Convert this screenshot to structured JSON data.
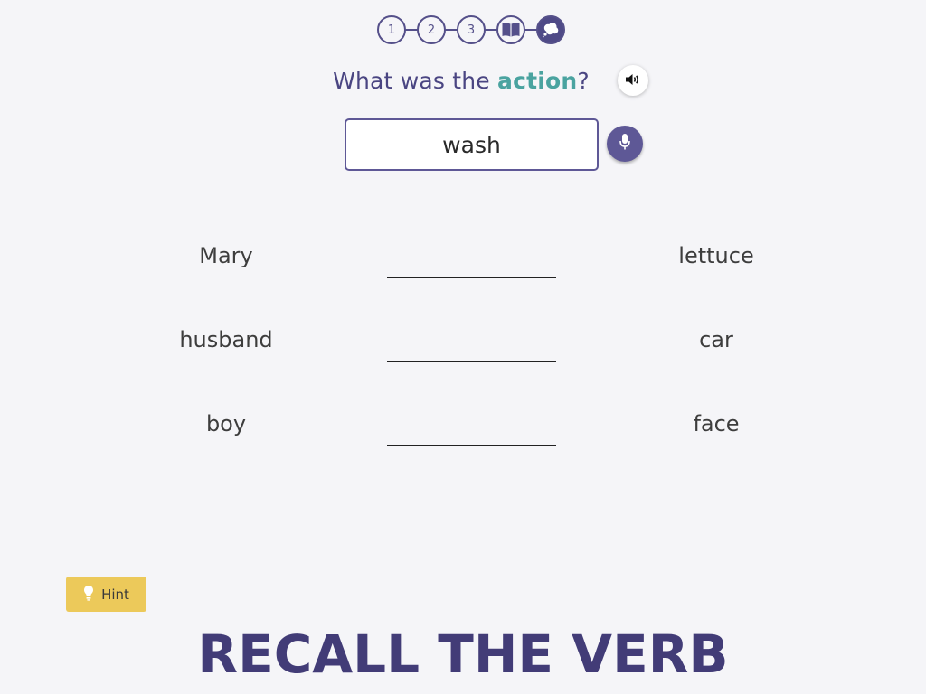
{
  "stepper": {
    "steps": [
      {
        "label": "1",
        "type": "number"
      },
      {
        "label": "2",
        "type": "number"
      },
      {
        "label": "3",
        "type": "number"
      },
      {
        "icon": "book-icon",
        "type": "icon"
      },
      {
        "icon": "thought-bubble-icon",
        "type": "icon",
        "active": true
      }
    ]
  },
  "question": {
    "prefix": "What was the ",
    "keyword": "action",
    "suffix": "?",
    "sound_icon": "speaker-icon"
  },
  "answer": {
    "value": "wash",
    "mic_icon": "microphone-icon"
  },
  "sentences": [
    {
      "subject": "Mary",
      "object": "lettuce"
    },
    {
      "subject": "husband",
      "object": "car"
    },
    {
      "subject": "boy",
      "object": "face"
    }
  ],
  "hint": {
    "label": "Hint",
    "icon": "lightbulb-icon"
  },
  "footer": {
    "title": "RECALL THE VERB"
  },
  "colors": {
    "primary": "#4f4a87",
    "keyword": "#4aa3a0",
    "hint": "#ecc95a",
    "background": "#f5f5f8"
  }
}
